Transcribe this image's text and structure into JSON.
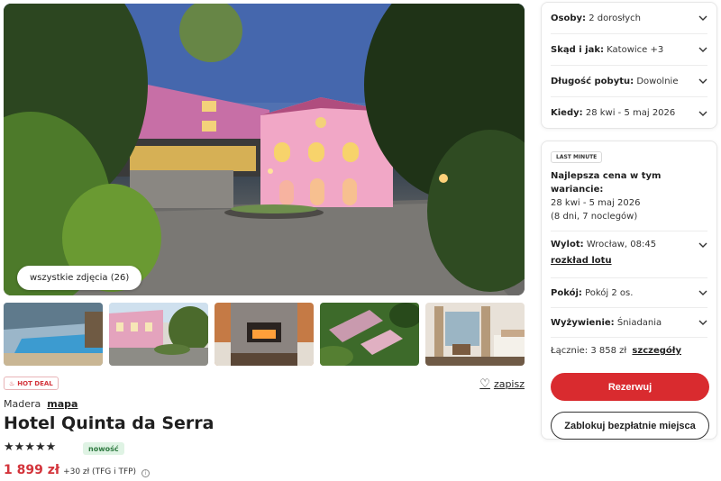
{
  "gallery": {
    "all_photos_label": "wszystkie zdjęcia (26)",
    "thumbnails": [
      {
        "icon": "pool-photo"
      },
      {
        "icon": "hotel-exterior-photo"
      },
      {
        "icon": "fireplace-photo"
      },
      {
        "icon": "aerial-view-photo"
      },
      {
        "icon": "room-interior-photo"
      }
    ]
  },
  "hotel": {
    "badge": "HOT DEAL",
    "save_label": "zapisz",
    "region": "Madera",
    "map_label": "mapa",
    "name": "Hotel Quinta da Serra",
    "stars": 5,
    "star_glyphs": "★★★★★",
    "new_label": "nowość",
    "price": "1 899 zł",
    "price_extra": "+30 zł (TFG i TFP)"
  },
  "filters": {
    "persons_label": "Osoby:",
    "persons_value": "2 dorosłych",
    "from_label": "Skąd i jak:",
    "from_value": "Katowice +3",
    "duration_label": "Długość pobytu:",
    "duration_value": "Dowolnie",
    "when_label": "Kiedy:",
    "when_value": "28 kwi - 5 maj 2026"
  },
  "offer": {
    "badge": "LAST MINUTE",
    "best_title": "Najlepsza cena w tym wariancie:",
    "dates": "28 kwi - 5 maj 2026",
    "nights": "(8 dni, 7 noclegów)",
    "departure_label": "Wylot:",
    "departure_value": "Wrocław, 08:45",
    "schedule_link": "rozkład lotu",
    "room_label": "Pokój:",
    "room_value": "Pokój 2 os.",
    "board_label": "Wyżywienie:",
    "board_value": "Śniadania",
    "total_label": "Łącznie:",
    "total_value": "3 858 zł",
    "details_link": "szczegóły",
    "book_button": "Rezerwuj",
    "hold_button": "Zablokuj bezpłatnie miejsca"
  },
  "colors": {
    "accent_red": "#d92b2f",
    "price_red": "#d3343b",
    "new_badge_bg": "#dff3e4"
  }
}
